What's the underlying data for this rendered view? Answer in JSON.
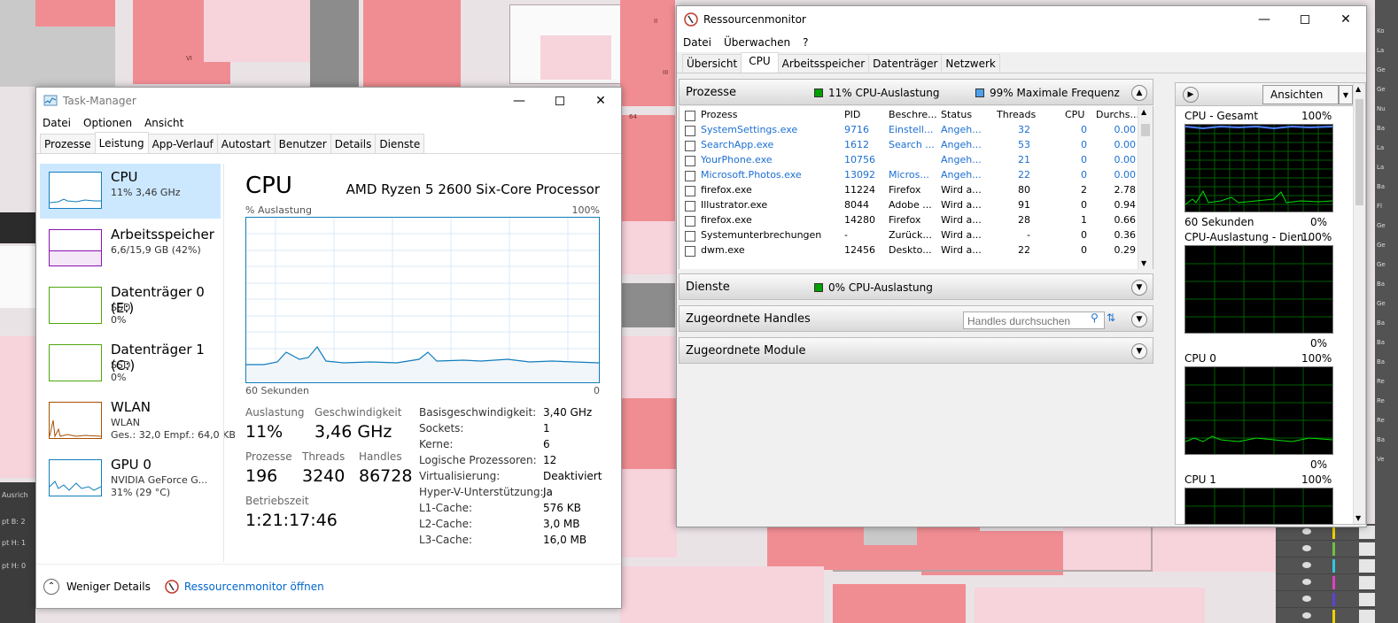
{
  "task_manager": {
    "title": "Task-Manager",
    "menu": [
      "Datei",
      "Optionen",
      "Ansicht"
    ],
    "tabs": [
      "Prozesse",
      "Leistung",
      "App-Verlauf",
      "Autostart",
      "Benutzer",
      "Details",
      "Dienste"
    ],
    "sidebar": [
      {
        "name": "CPU",
        "line1": "11% 3,46 GHz",
        "line2": ""
      },
      {
        "name": "Arbeitsspeicher",
        "line1": "6,6/15,9 GB (42%)",
        "line2": ""
      },
      {
        "name": "Datenträger 0 (E:)",
        "line1": "SSD",
        "line2": "0%"
      },
      {
        "name": "Datenträger 1 (C:)",
        "line1": "SSD",
        "line2": "0%"
      },
      {
        "name": "WLAN",
        "line1": "WLAN",
        "line2": "Ges.: 32,0 Empf.: 64,0 KB"
      },
      {
        "name": "GPU 0",
        "line1": "NVIDIA GeForce G...",
        "line2": "31% (29 °C)"
      }
    ],
    "main": {
      "heading": "CPU",
      "processor": "AMD Ryzen 5 2600 Six-Core Processor",
      "graph_top_left": "% Auslastung",
      "graph_top_right": "100%",
      "graph_bottom_left": "60 Sekunden",
      "graph_bottom_right": "0",
      "stats": {
        "auslastung_label": "Auslastung",
        "auslastung": "11%",
        "geschw_label": "Geschwindigkeit",
        "geschw": "3,46 GHz",
        "prozesse_label": "Prozesse",
        "prozesse": "196",
        "threads_label": "Threads",
        "threads": "3240",
        "handles_label": "Handles",
        "handles": "86728",
        "betrieb_label": "Betriebszeit",
        "betrieb": "1:21:17:46"
      },
      "details": [
        {
          "k": "Basisgeschwindigkeit:",
          "v": "3,40 GHz"
        },
        {
          "k": "Sockets:",
          "v": "1"
        },
        {
          "k": "Kerne:",
          "v": "6"
        },
        {
          "k": "Logische Prozessoren:",
          "v": "12"
        },
        {
          "k": "Virtualisierung:",
          "v": "Deaktiviert"
        },
        {
          "k": "Hyper-V-Unterstützung:",
          "v": "Ja"
        },
        {
          "k": "L1-Cache:",
          "v": "576 KB"
        },
        {
          "k": "L2-Cache:",
          "v": "3,0 MB"
        },
        {
          "k": "L3-Cache:",
          "v": "16,0 MB"
        }
      ]
    },
    "footer": {
      "less": "Weniger Details",
      "link": "Ressourcenmonitor öffnen"
    }
  },
  "resource_monitor": {
    "title": "Ressourcenmonitor",
    "menu": [
      "Datei",
      "Überwachen",
      "?"
    ],
    "tabs": [
      "Übersicht",
      "CPU",
      "Arbeitsspeicher",
      "Datenträger",
      "Netzwerk"
    ],
    "processes": {
      "label": "Prozesse",
      "cpu_usage": "11% CPU-Auslastung",
      "max_freq": "99% Maximale Frequenz",
      "columns": [
        "Prozess",
        "PID",
        "Beschre...",
        "Status",
        "Threads",
        "CPU",
        "Durchs..."
      ],
      "rows": [
        {
          "name": "SystemSettings.exe",
          "pid": "9716",
          "desc": "Einstell...",
          "status": "Angeh...",
          "threads": "32",
          "cpu": "0",
          "avg": "0.00",
          "suspended": true
        },
        {
          "name": "SearchApp.exe",
          "pid": "1612",
          "desc": "Search ...",
          "status": "Angeh...",
          "threads": "53",
          "cpu": "0",
          "avg": "0.00",
          "suspended": true
        },
        {
          "name": "YourPhone.exe",
          "pid": "10756",
          "desc": "",
          "status": "Angeh...",
          "threads": "21",
          "cpu": "0",
          "avg": "0.00",
          "suspended": true
        },
        {
          "name": "Microsoft.Photos.exe",
          "pid": "13092",
          "desc": "Micros...",
          "status": "Angeh...",
          "threads": "22",
          "cpu": "0",
          "avg": "0.00",
          "suspended": true
        },
        {
          "name": "firefox.exe",
          "pid": "11224",
          "desc": "Firefox",
          "status": "Wird a...",
          "threads": "80",
          "cpu": "2",
          "avg": "2.78",
          "suspended": false
        },
        {
          "name": "Illustrator.exe",
          "pid": "8044",
          "desc": "Adobe ...",
          "status": "Wird a...",
          "threads": "91",
          "cpu": "0",
          "avg": "0.94",
          "suspended": false
        },
        {
          "name": "firefox.exe",
          "pid": "14280",
          "desc": "Firefox",
          "status": "Wird a...",
          "threads": "28",
          "cpu": "1",
          "avg": "0.66",
          "suspended": false
        },
        {
          "name": "Systemunterbrechungen",
          "pid": "-",
          "desc": "Zurück...",
          "status": "Wird a...",
          "threads": "-",
          "cpu": "0",
          "avg": "0.36",
          "suspended": false
        },
        {
          "name": "dwm.exe",
          "pid": "12456",
          "desc": "Deskto...",
          "status": "Wird a...",
          "threads": "22",
          "cpu": "0",
          "avg": "0.29",
          "suspended": false
        }
      ]
    },
    "services": {
      "label": "Dienste",
      "cpu_usage": "0% CPU-Auslastung"
    },
    "handles": {
      "label": "Zugeordnete Handles",
      "search_placeholder": "Handles durchsuchen"
    },
    "modules": {
      "label": "Zugeordnete Module"
    },
    "right_panel": {
      "views_button": "Ansichten",
      "graphs": [
        {
          "title": "CPU - Gesamt",
          "max": "100%",
          "bottom_left": "60 Sekunden",
          "bottom_right": "0%"
        },
        {
          "title": "CPU-Auslastung - Dien...",
          "max": "100%",
          "bottom_left": "",
          "bottom_right": "0%"
        },
        {
          "title": "CPU 0",
          "max": "100%",
          "bottom_left": "",
          "bottom_right": "0%"
        },
        {
          "title": "CPU 1",
          "max": "100%",
          "bottom_left": "",
          "bottom_right": ""
        }
      ]
    }
  },
  "colors": {
    "accent_blue": "#117dbb",
    "green_graph": "#00c000",
    "link": "#0066cc"
  }
}
